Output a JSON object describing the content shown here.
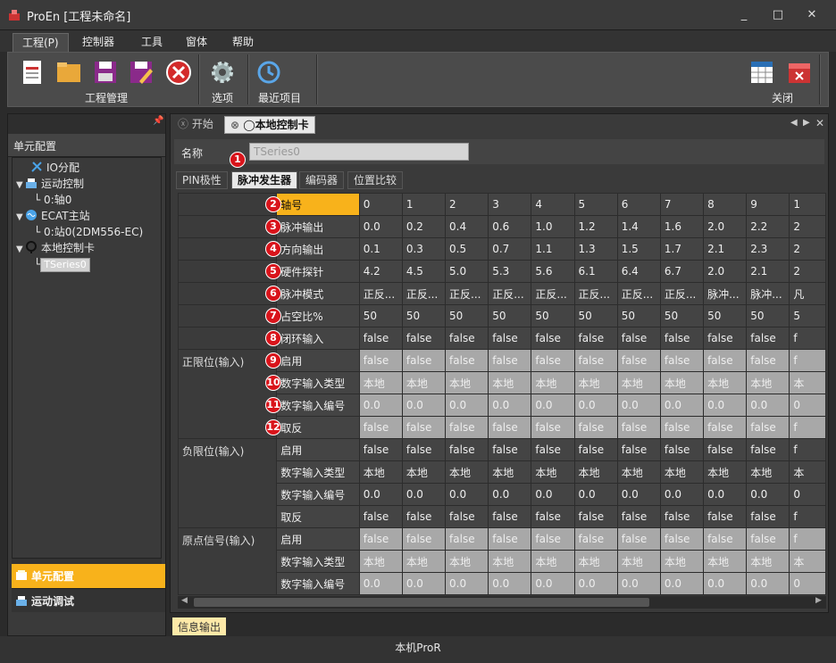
{
  "window": {
    "title": "ProEn [工程未命名]",
    "controls": [
      "_",
      "□",
      "✕"
    ]
  },
  "menu": [
    "工程(P)",
    "控制器",
    "工具",
    "窗体",
    "帮助"
  ],
  "ribbon": {
    "group1_label": "工程管理",
    "options_label": "选项",
    "recent_label": "最近项目",
    "close_label": "关闭"
  },
  "left_panel": {
    "header": "单元配置",
    "pin": "📌",
    "tree": [
      {
        "label": "IO分配"
      },
      {
        "label": "运动控制"
      },
      {
        "label": "0:轴0"
      },
      {
        "label": "ECAT主站"
      },
      {
        "label": "0:站0(2DM556-EC)"
      },
      {
        "label": "本地控制卡"
      },
      {
        "label": "TSeries0"
      }
    ],
    "nav": [
      "单元配置",
      "运动调试"
    ]
  },
  "doc_tabs": [
    "开始",
    "本地控制卡"
  ],
  "name_label": "名称",
  "name_value": "TSeries0",
  "sub_tabs": [
    "PIN极性",
    "脉冲发生器",
    "编码器",
    "位置比较"
  ],
  "badges": [
    "1",
    "2",
    "3",
    "4",
    "5",
    "6",
    "7",
    "8",
    "9",
    "10",
    "11",
    "12"
  ],
  "grid": {
    "groups": [
      "正限位(输入)",
      "负限位(输入)",
      "原点信号(输入)"
    ],
    "rows": [
      {
        "label": "轴号",
        "values": [
          "0",
          "1",
          "2",
          "3",
          "4",
          "5",
          "6",
          "7",
          "8",
          "9",
          "1"
        ]
      },
      {
        "label": "脉冲输出",
        "values": [
          "0.0",
          "0.2",
          "0.4",
          "0.6",
          "1.0",
          "1.2",
          "1.4",
          "1.6",
          "2.0",
          "2.2",
          "2"
        ]
      },
      {
        "label": "方向输出",
        "values": [
          "0.1",
          "0.3",
          "0.5",
          "0.7",
          "1.1",
          "1.3",
          "1.5",
          "1.7",
          "2.1",
          "2.3",
          "2"
        ]
      },
      {
        "label": "硬件探针",
        "values": [
          "4.2",
          "4.5",
          "5.0",
          "5.3",
          "5.6",
          "6.1",
          "6.4",
          "6.7",
          "2.0",
          "2.1",
          "2"
        ]
      },
      {
        "label": "脉冲模式",
        "values": [
          "正反...",
          "正反...",
          "正反...",
          "正反...",
          "正反...",
          "正反...",
          "正反...",
          "正反...",
          "脉冲...",
          "脉冲...",
          "凡"
        ]
      },
      {
        "label": "占空比%",
        "values": [
          "50",
          "50",
          "50",
          "50",
          "50",
          "50",
          "50",
          "50",
          "50",
          "50",
          "5"
        ]
      },
      {
        "label": "闭环输入",
        "values": [
          "false",
          "false",
          "false",
          "false",
          "false",
          "false",
          "false",
          "false",
          "false",
          "false",
          "f"
        ]
      },
      {
        "label": "启用",
        "values": [
          "false",
          "false",
          "false",
          "false",
          "false",
          "false",
          "false",
          "false",
          "false",
          "false",
          "f"
        ]
      },
      {
        "label": "数字输入类型",
        "values": [
          "本地",
          "本地",
          "本地",
          "本地",
          "本地",
          "本地",
          "本地",
          "本地",
          "本地",
          "本地",
          "本"
        ]
      },
      {
        "label": "数字输入编号",
        "values": [
          "0.0",
          "0.0",
          "0.0",
          "0.0",
          "0.0",
          "0.0",
          "0.0",
          "0.0",
          "0.0",
          "0.0",
          "0"
        ]
      },
      {
        "label": "取反",
        "values": [
          "false",
          "false",
          "false",
          "false",
          "false",
          "false",
          "false",
          "false",
          "false",
          "false",
          "f"
        ]
      },
      {
        "label": "启用",
        "values": [
          "false",
          "false",
          "false",
          "false",
          "false",
          "false",
          "false",
          "false",
          "false",
          "false",
          "f"
        ]
      },
      {
        "label": "数字输入类型",
        "values": [
          "本地",
          "本地",
          "本地",
          "本地",
          "本地",
          "本地",
          "本地",
          "本地",
          "本地",
          "本地",
          "本"
        ]
      },
      {
        "label": "数字输入编号",
        "values": [
          "0.0",
          "0.0",
          "0.0",
          "0.0",
          "0.0",
          "0.0",
          "0.0",
          "0.0",
          "0.0",
          "0.0",
          "0"
        ]
      },
      {
        "label": "取反",
        "values": [
          "false",
          "false",
          "false",
          "false",
          "false",
          "false",
          "false",
          "false",
          "false",
          "false",
          "f"
        ]
      },
      {
        "label": "启用",
        "values": [
          "false",
          "false",
          "false",
          "false",
          "false",
          "false",
          "false",
          "false",
          "false",
          "false",
          "f"
        ]
      },
      {
        "label": "数字输入类型",
        "values": [
          "本地",
          "本地",
          "本地",
          "本地",
          "本地",
          "本地",
          "本地",
          "本地",
          "本地",
          "本地",
          "本"
        ]
      },
      {
        "label": "数字输入编号",
        "values": [
          "0.0",
          "0.0",
          "0.0",
          "0.0",
          "0.0",
          "0.0",
          "0.0",
          "0.0",
          "0.0",
          "0.0",
          "0"
        ]
      }
    ]
  },
  "output_tab": "信息输出",
  "status": "本机ProR"
}
